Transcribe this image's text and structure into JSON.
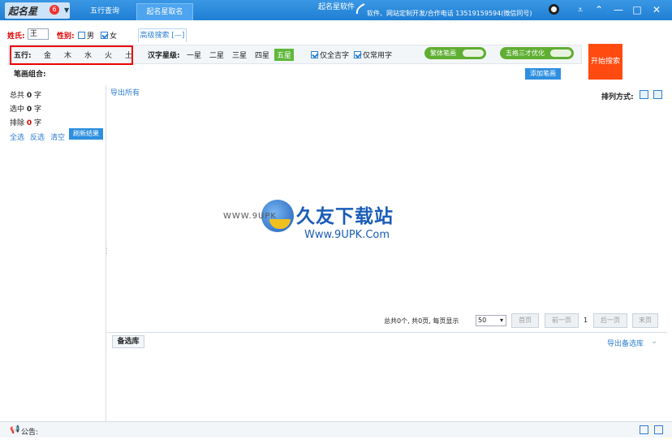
{
  "titlebar": {
    "app_name": "起名星软件",
    "badge": "6",
    "tabs": [
      "五行查询",
      "起名星取名"
    ],
    "contact": "软件、网站定制开发/合作电话 13519159594(微信同号)"
  },
  "search": {
    "surname_label": "姓氏:",
    "surname_value": "王",
    "gender_label": "性别:",
    "gender_male": "男",
    "gender_female": "女",
    "advanced_tab": "高级搜索 [—]",
    "wuxing_label": "五行:",
    "wuxing": [
      "金",
      "木",
      "水",
      "火",
      "土"
    ],
    "star_label": "汉字星级:",
    "stars": [
      "一星",
      "二星",
      "三星",
      "四星",
      "五星"
    ],
    "only_auspicious": "仅全吉字",
    "only_common": "仅常用字",
    "toggle_traditional": "繁体笔画",
    "toggle_sancai": "五格三才优化",
    "stroke_label": "笔画组合:",
    "add_stroke_button": "添加笔画",
    "start_button": "开始搜索"
  },
  "left": {
    "total_label": "总共",
    "total_value": "0",
    "selected_label": "选中",
    "selected_value": "0",
    "excluded_label": "排除",
    "excluded_value": "0",
    "unit": "字",
    "select_all": "全选",
    "invert": "反选",
    "clear": "清空",
    "refresh": "刷新结果"
  },
  "main": {
    "export_all": "导出所有",
    "sort_label": "排列方式:",
    "watermark_prefix": "WWW.9UPK",
    "watermark_title": "久友下载站",
    "watermark_url": "Www.9UPK.Com",
    "pager_summary": "总共0个, 共0页, 每页显示",
    "page_size": "50",
    "first_page": "首页",
    "prev_page": "前一页",
    "current_page": "1",
    "next_page": "后一页",
    "last_page": "末页"
  },
  "bottom": {
    "tab": "备选库",
    "export": "导出备选库"
  },
  "status": {
    "notice": "公告:"
  }
}
